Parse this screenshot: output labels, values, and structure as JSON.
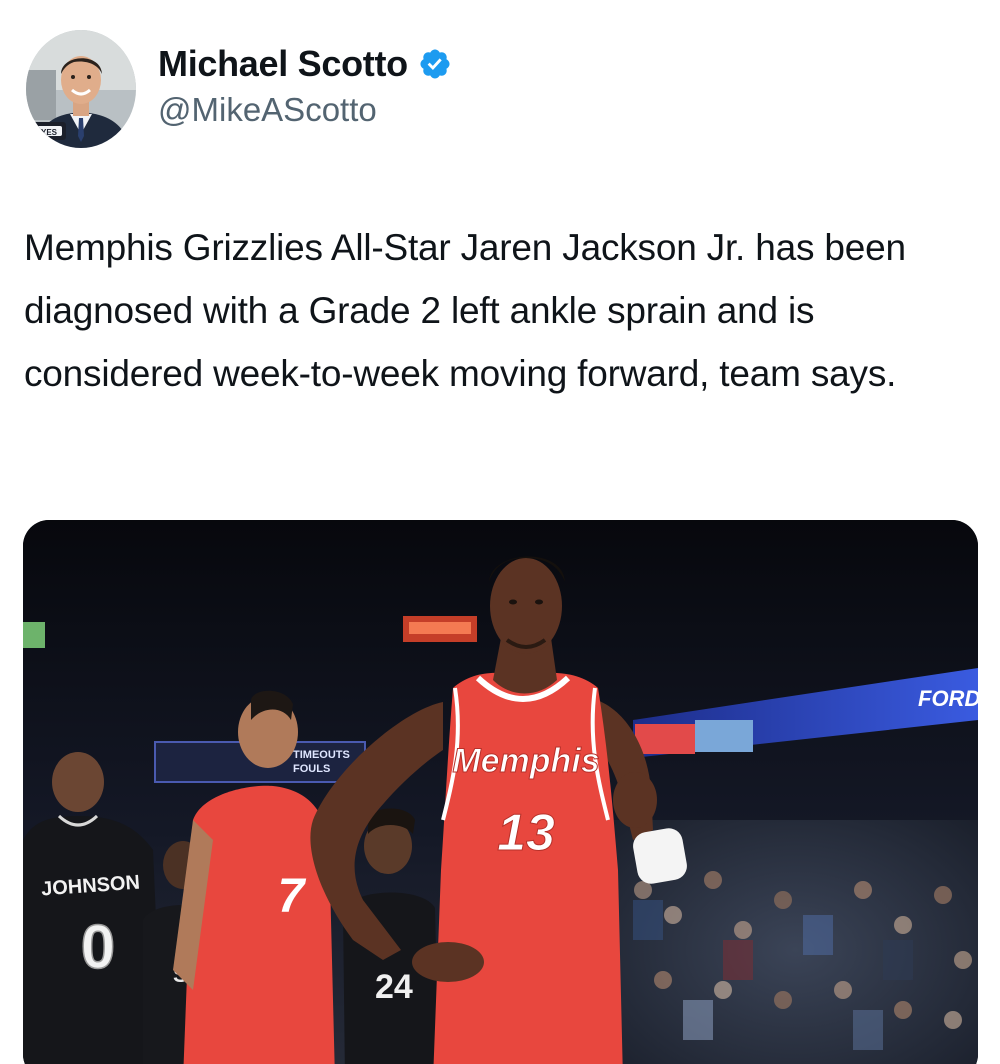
{
  "author": {
    "display_name": "Michael Scotto",
    "handle": "@MikeAScotto",
    "verified": true,
    "verified_color": "#1d9bf0",
    "avatar_icon": "profile-photo"
  },
  "tweet": {
    "text": "Memphis Grizzlies All-Star Jaren Jackson Jr. has been diagnosed with a Grade 2 left ankle sprain and is considered week-to-week moving forward, team says."
  },
  "media": {
    "type": "photo",
    "jersey_front_text": "Memphis",
    "jersey_front_number": "13",
    "opponent_name": "JOHNSON",
    "opponent_number": "0",
    "opponent_chest_text": "SP",
    "opponent2_number": "24",
    "teammate_number": "7",
    "arena_sign": "FORD",
    "scoreboard_text_1": "TIMEOUTS",
    "scoreboard_text_2": "FOULS",
    "avatar_badge_text": "YES",
    "colors": {
      "home_jersey": "#e8473e",
      "away_jersey": "#15161a",
      "ribbon": "#2a45b8"
    }
  }
}
